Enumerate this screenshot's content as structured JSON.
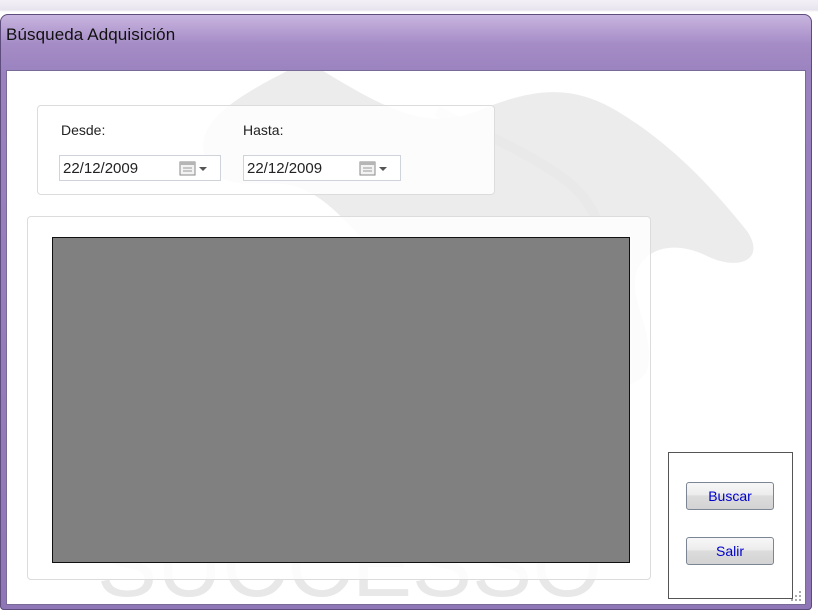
{
  "window": {
    "title": "Búsqueda Adquisición"
  },
  "filters": {
    "desde_label": "Desde:",
    "desde_value": "22/12/2009",
    "hasta_label": "Hasta:",
    "hasta_value": "22/12/2009"
  },
  "actions": {
    "buscar_label": "Buscar",
    "salir_label": "Salir"
  },
  "colors": {
    "frame": "#9a82bf",
    "grid_background": "#808080",
    "button_text": "#0000cc"
  },
  "icons": [
    "calendar-icon",
    "dropdown-arrow-icon",
    "resize-grip-icon"
  ]
}
